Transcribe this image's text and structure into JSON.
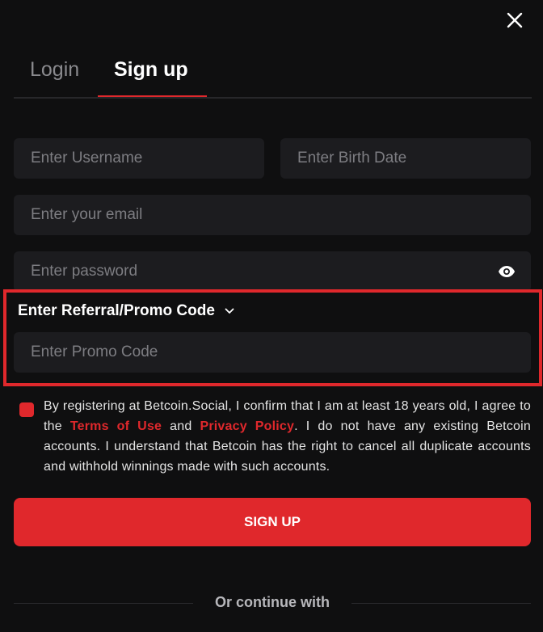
{
  "tabs": {
    "login": "Login",
    "signup": "Sign up"
  },
  "form": {
    "username_placeholder": "Enter Username",
    "birthdate_placeholder": "Enter Birth Date",
    "email_placeholder": "Enter your email",
    "password_placeholder": "Enter password",
    "promo_toggle_label": "Enter Referral/Promo Code",
    "promo_placeholder": "Enter Promo Code"
  },
  "terms": {
    "text_before": "By registering at Betcoin.Social, I confirm that I am at least 18 years old, I agree to the ",
    "terms_link": "Terms of Use",
    "text_and": " and ",
    "privacy_link": "Privacy Policy",
    "text_after": ". I do not have any existing Betcoin accounts. I understand that Betcoin has the right to cancel all duplicate accounts and withhold winnings made with such accounts.",
    "checked": true
  },
  "signup_button": "SIGN UP",
  "continue_with": "Or continue with",
  "icons": {
    "close": "close-icon",
    "eye": "eye-icon",
    "chevron": "chevron-down-icon"
  },
  "colors": {
    "accent": "#e0282c",
    "background": "#0f0f10",
    "input": "#1c1c1f"
  }
}
